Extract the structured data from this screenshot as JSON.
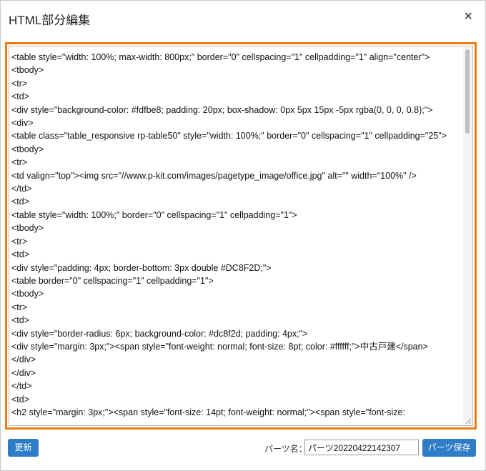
{
  "dialog": {
    "title": "HTML部分編集",
    "close_label": "×"
  },
  "editor": {
    "lines": [
      "<table style=\"width: 100%; max-width: 800px;\" border=\"0\" cellspacing=\"1\" cellpadding=\"1\" align=\"center\">",
      "<tbody>",
      "<tr>",
      "<td>",
      "<div style=\"background-color: #fdfbe8; padding: 20px; box-shadow: 0px 5px 15px -5px rgba(0, 0, 0, 0.8);\">",
      "<div>",
      "<table class=\"table_responsive rp-table50\" style=\"width: 100%;\" border=\"0\" cellspacing=\"1\" cellpadding=\"25\">",
      "<tbody>",
      "<tr>",
      "<td valign=\"top\"><img src=\"//www.p-kit.com/images/pagetype_image/office.jpg\" alt=\"\" width=\"100%\" />",
      "</td>",
      "<td>",
      "<table style=\"width: 100%;\" border=\"0\" cellspacing=\"1\" cellpadding=\"1\">",
      "<tbody>",
      "<tr>",
      "<td>",
      "<div style=\"padding: 4px; border-bottom: 3px double #DC8F2D;\">",
      "<table border=\"0\" cellspacing=\"1\" cellpadding=\"1\">",
      "<tbody>",
      "<tr>",
      "<td>",
      "<div style=\"border-radius: 6px; background-color: #dc8f2d; padding: 4px;\">",
      "<div style=\"margin: 3px;\"><span style=\"font-weight: normal; font-size: 8pt; color: #ffffff;\">中古戸建</span>",
      "</div>",
      "</div>",
      "</td>",
      "<td>",
      "<h2 style=\"margin: 3px;\"><span style=\"font-size: 14pt; font-weight: normal;\"><span style=\"font-size:"
    ]
  },
  "footer": {
    "update_label": "更新",
    "parts_name_label": "パーツ名：",
    "parts_name_value": "パーツ20220422142307",
    "save_label": "パーツ保存"
  },
  "colors": {
    "accent_border": "#e87d12",
    "button_bg": "#2f7cc7"
  }
}
